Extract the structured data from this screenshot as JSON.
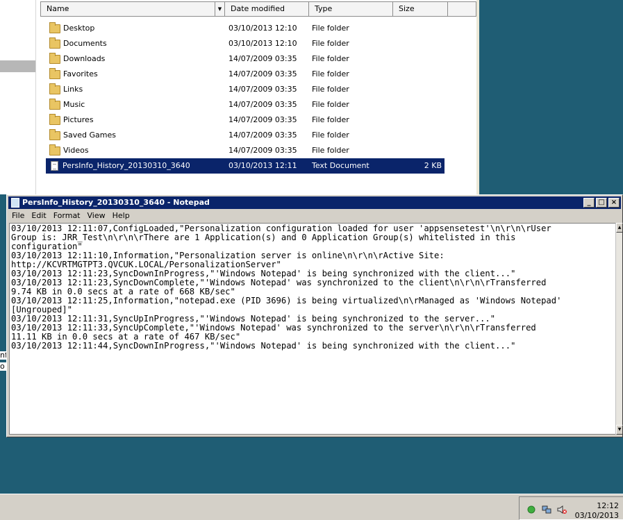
{
  "explorer": {
    "columns": {
      "name": "Name",
      "date": "Date modified",
      "type": "Type",
      "size": "Size"
    },
    "rows": [
      {
        "name": "Desktop",
        "date": "03/10/2013 12:10",
        "type": "File folder",
        "size": "",
        "icon": "folder-desktop-icon"
      },
      {
        "name": "Documents",
        "date": "03/10/2013 12:10",
        "type": "File folder",
        "size": "",
        "icon": "folder-documents-icon"
      },
      {
        "name": "Downloads",
        "date": "14/07/2009 03:35",
        "type": "File folder",
        "size": "",
        "icon": "folder-downloads-icon"
      },
      {
        "name": "Favorites",
        "date": "14/07/2009 03:35",
        "type": "File folder",
        "size": "",
        "icon": "folder-favorites-icon"
      },
      {
        "name": "Links",
        "date": "14/07/2009 03:35",
        "type": "File folder",
        "size": "",
        "icon": "folder-links-icon"
      },
      {
        "name": "Music",
        "date": "14/07/2009 03:35",
        "type": "File folder",
        "size": "",
        "icon": "folder-music-icon"
      },
      {
        "name": "Pictures",
        "date": "14/07/2009 03:35",
        "type": "File folder",
        "size": "",
        "icon": "folder-pictures-icon"
      },
      {
        "name": "Saved Games",
        "date": "14/07/2009 03:35",
        "type": "File folder",
        "size": "",
        "icon": "folder-saved-games-icon"
      },
      {
        "name": "Videos",
        "date": "14/07/2009 03:35",
        "type": "File folder",
        "size": "",
        "icon": "folder-videos-icon"
      },
      {
        "name": "PersInfo_History_20130310_3640",
        "date": "03/10/2013 12:11",
        "type": "Text Document",
        "size": "2 KB",
        "icon": "text-document-icon",
        "selected": true
      }
    ]
  },
  "notepad": {
    "title": "PersInfo_History_20130310_3640 - Notepad",
    "menu": {
      "file": "File",
      "edit": "Edit",
      "format": "Format",
      "view": "View",
      "help": "Help"
    },
    "lines": [
      "03/10/2013 12:11:07,ConfigLoaded,\"Personalization configuration loaded for user 'appsensetest'\\n\\r\\n\\rUser",
      "Group is: JRR_Test\\n\\r\\n\\rThere are 1 Application(s) and 0 Application Group(s) whitelisted in this",
      "configuration\"",
      "03/10/2013 12:11:10,Information,\"Personalization server is online\\n\\r\\n\\rActive Site:",
      "http://KCVRTMGTPT3.QVCUK.LOCAL/PersonalizationServer\"",
      "03/10/2013 12:11:23,SyncDownInProgress,\"'Windows Notepad' is being synchronized with the client...\"",
      "03/10/2013 12:11:23,SyncDownComplete,\"'Windows Notepad' was synchronized to the client\\n\\r\\n\\rTransferred",
      "9.74 KB in 0.0 secs at a rate of 668 KB/sec\"",
      "03/10/2013 12:11:25,Information,\"notepad.exe (PID 3696) is being virtualized\\n\\rManaged as 'Windows Notepad'",
      "[Ungrouped]\"",
      "03/10/2013 12:11:31,SyncUpInProgress,\"'Windows Notepad' is being synchronized to the server...\"",
      "03/10/2013 12:11:33,SyncUpComplete,\"'Windows Notepad' was synchronized to the server\\n\\r\\n\\rTransferred",
      "11.11 KB in 0.0 secs at a rate of 467 KB/sec\"",
      "03/10/2013 12:11:44,SyncDownInProgress,\"'Windows Notepad' is being synchronized with the client...\""
    ]
  },
  "desktop_fragments": {
    "frag1": "nf",
    "frag2": "o"
  },
  "taskbar": {
    "time": "12:12",
    "date": "03/10/2013"
  }
}
